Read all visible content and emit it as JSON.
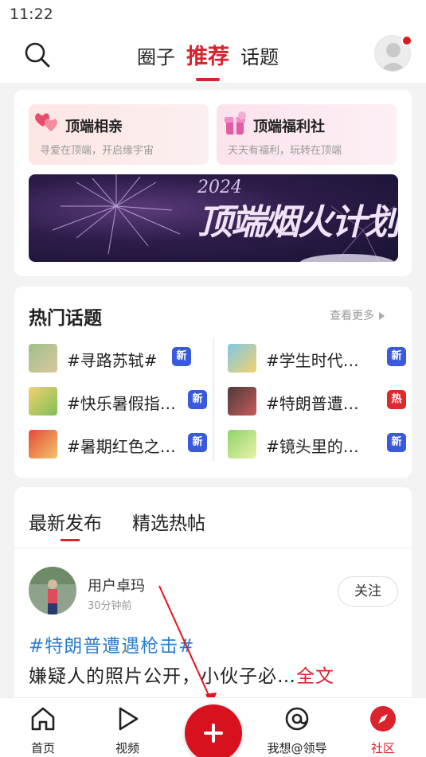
{
  "status_bar": {
    "time": "11:22"
  },
  "top_nav": {
    "tabs": [
      {
        "label": "圈子",
        "active": false
      },
      {
        "label": "推荐",
        "active": true
      },
      {
        "label": "话题",
        "active": false
      }
    ]
  },
  "features": [
    {
      "title": "顶端相亲",
      "subtitle": "寻爱在顶端，开启缘宇宙",
      "icon": "hearts-icon"
    },
    {
      "title": "顶端福利社",
      "subtitle": "天天有福利，玩转在顶端",
      "icon": "gift-icon"
    }
  ],
  "banner": {
    "year": "2024",
    "title": "顶端烟火计划"
  },
  "hot_topics": {
    "heading": "热门话题",
    "more_label": "查看更多",
    "items": [
      {
        "name": "#寻路苏轼#",
        "badge": "新",
        "badge_color": "#3a5bd9"
      },
      {
        "name": "#学生时代…",
        "badge": "新",
        "badge_color": "#3a5bd9"
      },
      {
        "name": "#快乐暑假指…",
        "badge": "新",
        "badge_color": "#3a5bd9"
      },
      {
        "name": "#特朗普遭…",
        "badge": "热",
        "badge_color": "#e0282e"
      },
      {
        "name": "#暑期红色之…",
        "badge": "新",
        "badge_color": "#3a5bd9"
      },
      {
        "name": "#镜头里的…",
        "badge": "新",
        "badge_color": "#3a5bd9"
      }
    ]
  },
  "feed": {
    "tabs": [
      {
        "label": "最新发布",
        "active": true
      },
      {
        "label": "精选热帖",
        "active": false
      }
    ],
    "post": {
      "user": "用户卓玛",
      "time": "30分钟前",
      "follow_label": "关注",
      "tag": "#特朗普遭遇枪击#",
      "text": "嫌疑人的照片公开，小伙子必…",
      "full_label": "全文"
    }
  },
  "bottom_nav": {
    "items": [
      {
        "label": "首页",
        "icon": "home-icon",
        "active": false
      },
      {
        "label": "视频",
        "icon": "play-icon",
        "active": false
      },
      {
        "label": "我想@领导",
        "icon": "at-icon",
        "active": false
      },
      {
        "label": "社区",
        "icon": "compass-icon",
        "active": true
      }
    ]
  },
  "colors": {
    "accent": "#d9232d",
    "link": "#2c7fcf"
  }
}
